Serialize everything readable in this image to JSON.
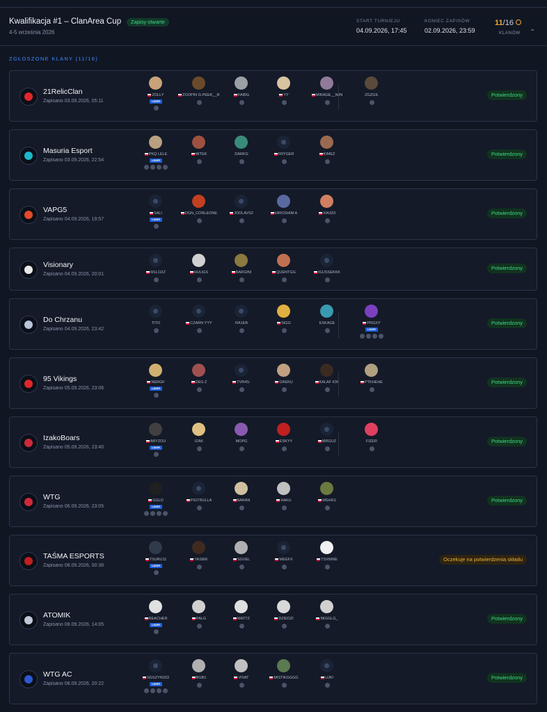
{
  "header": {
    "title": "Kwalifikacja #1 – ClanArea Cup",
    "badge": "Zapisy otwarte",
    "date": "4-5 września 2026",
    "start_label": "START TURNIEJU",
    "start_value": "04.09.2026, 17:45",
    "end_label": "KONIEC ZAPISÓW",
    "end_value": "02.09.2026, 23:59",
    "count_current": "11",
    "count_total": "/16",
    "count_label": "KLANÓW"
  },
  "section_label": "ZGŁOSZONE KLANY (11/16)",
  "colors": {
    "ok": "#3ddc84",
    "wait": "#f0b13a",
    "accent": "#3d8bff",
    "lider": "#1f5fd6"
  },
  "lider_label": "LIDER",
  "clans": [
    {
      "name": "21RelicClan",
      "sub": "Zapisano 03.09.2026, 05:11",
      "status": "Potwierdzony",
      "logo": "#e0262b",
      "players": [
        {
          "n": "ZOLLY",
          "l": true,
          "f": true,
          "a": "#c9a27a"
        },
        {
          "n": "ZOOPIN G-PEEK__RUDYRYDZA",
          "f": true,
          "a": "#6b4a2a"
        },
        {
          "n": "FAIBG",
          "f": true,
          "a": "#9aa0a6"
        },
        {
          "n": "YY",
          "f": true,
          "a": "#d8c4a0"
        },
        {
          "n": "MIRAGE__WIN",
          "f": true,
          "a": "#8f7a9a"
        }
      ],
      "subs": [
        {
          "n": "ZGZGIL",
          "a": "#5a4a3a"
        }
      ]
    },
    {
      "name": "Masuria Esport",
      "sub": "Zapisano 03.09.2026, 22:54",
      "status": "Potwierdzony",
      "logo": "#1bb7c9",
      "players": [
        {
          "n": "PKQ LELE",
          "l": true,
          "f": true,
          "a": "#b8a080"
        },
        {
          "n": "MITEK",
          "f": true,
          "a": "#a05040"
        },
        {
          "n": "DARKG",
          "a": "#3a8a7a"
        },
        {
          "n": "FRYGER",
          "f": true,
          "e": true
        },
        {
          "n": "KIMEZ",
          "f": true,
          "a": "#9a6a50"
        }
      ],
      "subs": []
    },
    {
      "name": "VAPG5",
      "sub": "Zapisano 04.09.2026, 19:57",
      "status": "Potwierdzony",
      "logo": "#e24a2a",
      "players": [
        {
          "n": "SALI",
          "l": true,
          "f": true,
          "e": true
        },
        {
          "n": "DGN_CORLEONE",
          "f": true,
          "a": "#c04020"
        },
        {
          "n": "JODLAVS2",
          "f": true,
          "e": true
        },
        {
          "n": "HIROSHIM A",
          "f": true,
          "a": "#5a6aa0"
        },
        {
          "n": "XIA333",
          "f": true,
          "a": "#d08060"
        }
      ],
      "subs": []
    },
    {
      "name": "Visionary",
      "sub": "Zapisano 04.09.2026, 20:01",
      "status": "Potwierdzony",
      "logo": "#e8e8e8",
      "players": [
        {
          "n": "M1LOZZ",
          "f": true,
          "e": true
        },
        {
          "n": "HULIGS",
          "f": true,
          "a": "#d0d0d0"
        },
        {
          "n": "BARGINI",
          "f": true,
          "a": "#8a7a40"
        },
        {
          "n": "QUENTGG",
          "f": true,
          "a": "#c07050"
        },
        {
          "n": "IGUSSEKKK",
          "f": true,
          "e": true
        }
      ],
      "subs": []
    },
    {
      "name": "Do Chrzanu",
      "sub": "Zapisano 04.09.2026, 23:42",
      "status": "Potwierdzony",
      "logo": "#b8c4d8",
      "players": [
        {
          "n": "TITO",
          "e": true
        },
        {
          "n": "CZARN YYY",
          "f": true,
          "e": true
        },
        {
          "n": "RA1EB",
          "e": true
        },
        {
          "n": "SIGG",
          "f": true,
          "a": "#e0b040"
        },
        {
          "n": "ESKAGE",
          "a": "#3a9ab0"
        }
      ],
      "subs": [
        {
          "n": "PRGXY",
          "l": true,
          "f": true,
          "a": "#7a40c0"
        }
      ]
    },
    {
      "name": "95 Vikings",
      "sub": "Zapisano 05.09.2026, 23:06",
      "status": "Potwierdzony",
      "logo": "#e0262b",
      "players": [
        {
          "n": "NERGF",
          "l": true,
          "f": true,
          "a": "#d0b070"
        },
        {
          "n": "DEG Z",
          "f": true,
          "a": "#a05050"
        },
        {
          "n": "TVR4S-",
          "f": true,
          "e": true
        },
        {
          "n": "GREKU",
          "f": true,
          "a": "#c0a080"
        },
        {
          "n": "KALAF IOR",
          "f": true,
          "a": "#3a2a20"
        }
      ],
      "subs": [
        {
          "n": "PTKHEHE",
          "f": true,
          "a": "#b0a080"
        }
      ]
    },
    {
      "name": "IzakoBoars",
      "sub": "Zapisano 05.09.2026, 23:40",
      "status": "Potwierdzony",
      "logo": "#d02a3a",
      "players": [
        {
          "n": "ABYZOU",
          "l": true,
          "f": true,
          "a": "#404040"
        },
        {
          "n": "IZAK",
          "a": "#e0c080"
        },
        {
          "n": "MOPG",
          "a": "#8a5ab0"
        },
        {
          "n": "ESKYY",
          "f": true,
          "a": "#c02020"
        },
        {
          "n": "MRGUZ",
          "f": true,
          "e": true
        }
      ],
      "subs": [
        {
          "n": "FIZER",
          "a": "#e04060"
        }
      ]
    },
    {
      "name": "WTG",
      "sub": "Zapisano 06.09.2026, 23:05",
      "status": "Potwierdzony",
      "logo": "#d02a3a",
      "players": [
        {
          "n": "GGLD",
          "l": true,
          "f": true,
          "a": "#202020"
        },
        {
          "n": "PIGTRULLA",
          "f": true,
          "e": true
        },
        {
          "n": "BARAN",
          "f": true,
          "a": "#d0c0a0"
        },
        {
          "n": "HAKU",
          "f": true,
          "a": "#c0c0c0"
        },
        {
          "n": "MSHKS",
          "f": true,
          "a": "#6a7a40"
        }
      ],
      "subs": []
    },
    {
      "name": "TAŚMA ESPORTS",
      "sub": "Zapisano 08.09.2026, 00:38",
      "status": "Oczekuje na potwierdzenia składu",
      "wait": true,
      "logo": "#c02020",
      "players": [
        {
          "n": "TSURU11",
          "l": true,
          "f": true,
          "a": "#303a4a"
        },
        {
          "n": "YASIEK",
          "f": true,
          "a": "#402a20"
        },
        {
          "n": "SGVEL",
          "f": true,
          "a": "#b0b0b0"
        },
        {
          "n": "WEEFX",
          "f": true,
          "e": true
        },
        {
          "n": "TSXNINE",
          "f": true,
          "a": "#f0f0f0"
        }
      ],
      "subs": []
    },
    {
      "name": "ATOMIK",
      "sub": "Zapisano 08.09.2026, 14:05",
      "status": "Potwierdzony",
      "logo": "#c0c8d8",
      "players": [
        {
          "n": "REACHER",
          "l": true,
          "f": true,
          "a": "#e0e0e0"
        },
        {
          "n": "PALG",
          "f": true,
          "a": "#d0d0d0"
        },
        {
          "n": "MATTZ",
          "f": true,
          "a": "#e0e0e0"
        },
        {
          "n": "DZIEDZI",
          "f": true,
          "a": "#d8d8d8"
        },
        {
          "n": "MIGGLG_",
          "f": true,
          "a": "#d0d0d0"
        }
      ],
      "subs": []
    },
    {
      "name": "WTG AC",
      "sub": "Zapisano 08.09.2026, 20:22",
      "status": "Potwierdzony",
      "logo": "#2a5ad0",
      "players": [
        {
          "n": "SGSZYN333",
          "l": true,
          "f": true,
          "e": true
        },
        {
          "n": "BGB1",
          "f": true,
          "a": "#b0b0b0"
        },
        {
          "n": "VIVAT",
          "f": true,
          "a": "#c0c0c0"
        },
        {
          "n": "MISTIKGGGG",
          "f": true,
          "a": "#5a7a50"
        },
        {
          "n": "UJKI",
          "f": true,
          "e": true
        }
      ],
      "subs": []
    }
  ]
}
